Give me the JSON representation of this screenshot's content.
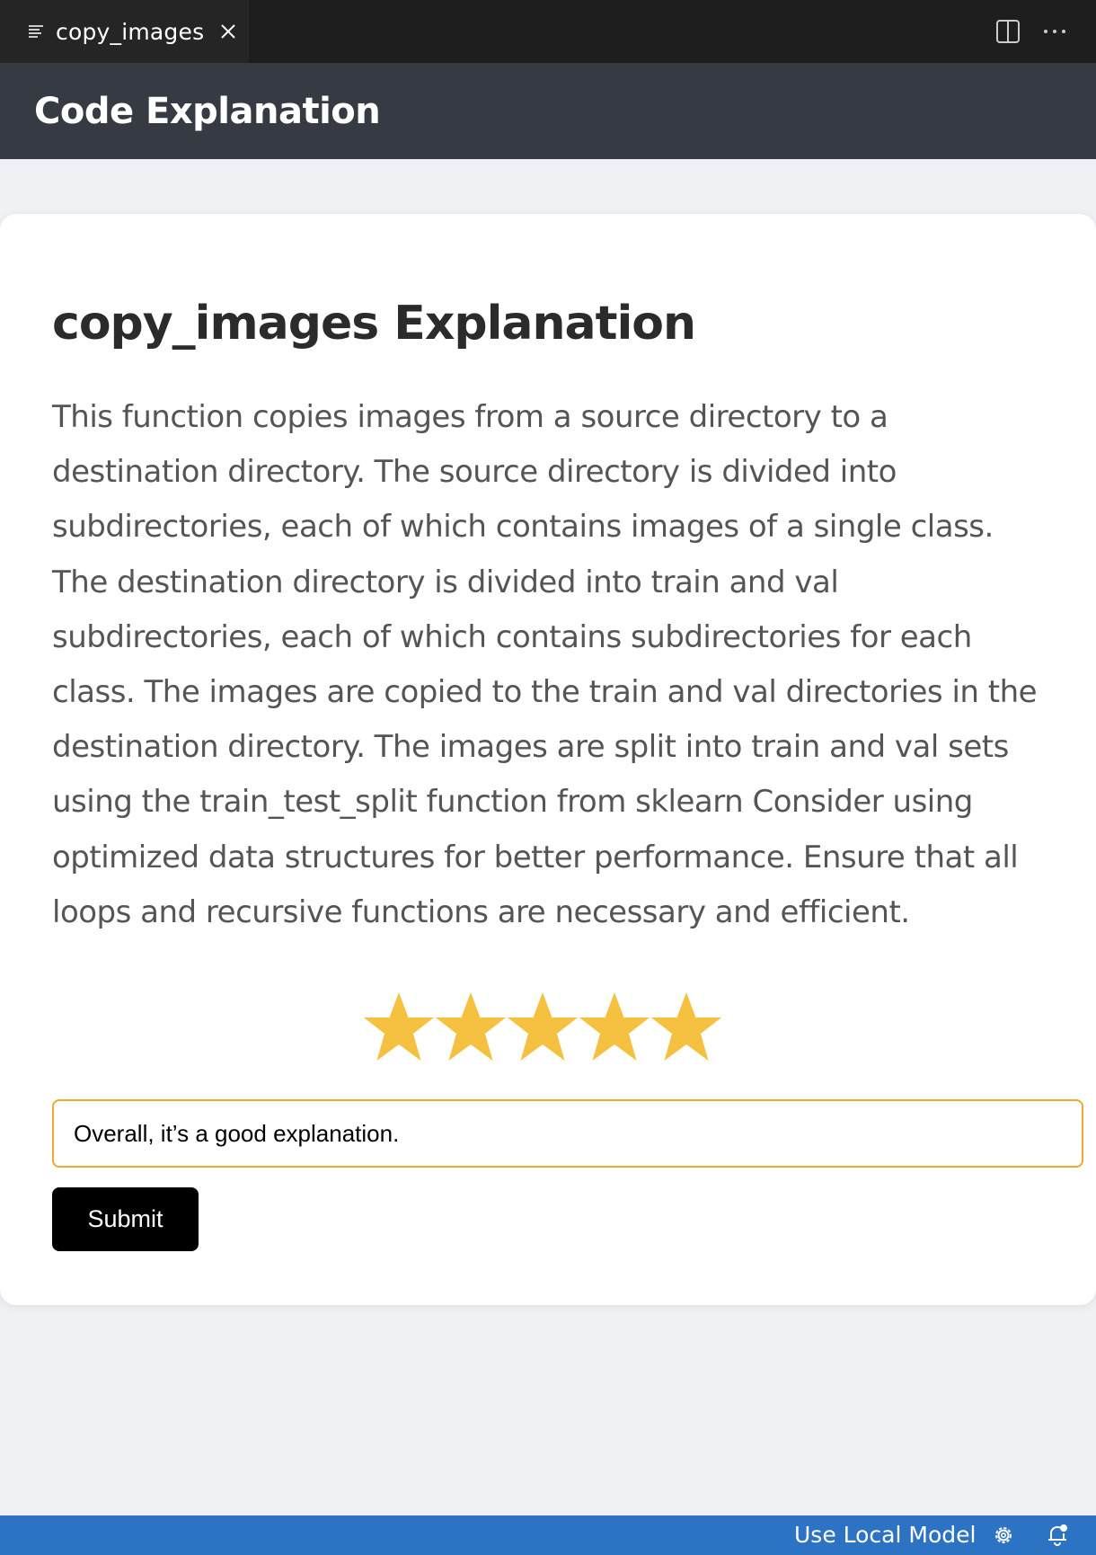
{
  "tab": {
    "label": "copy_images",
    "icon": "preview-icon"
  },
  "header": {
    "title": "Code Explanation"
  },
  "explanation": {
    "title": "copy_images Explanation",
    "body": "This function copies images from a source directory to a destination directory. The source directory is divided into subdirectories, each of which contains images of a single class. The destination directory is divided into train and val subdirectories, each of which contains subdirectories for each class. The images are copied to the train and val directories in the destination directory. The images are split into train and val sets using the train_test_split function from sklearn Consider using optimized data structures for better performance. Ensure that all loops and recursive functions are necessary and efficient."
  },
  "rating": {
    "value": 5,
    "max": 5,
    "star_color": "#f6c040"
  },
  "feedback": {
    "value": "Overall, it’s a good explanation.",
    "border_color": "#f0a830"
  },
  "submit": {
    "label": "Submit"
  },
  "statusbar": {
    "model_label": "Use Local Model",
    "background": "#2c73c4"
  },
  "colors": {
    "header_bg": "#363a43",
    "tabbar_bg": "#1e1e1e",
    "page_bg": "#f0f1f5"
  }
}
